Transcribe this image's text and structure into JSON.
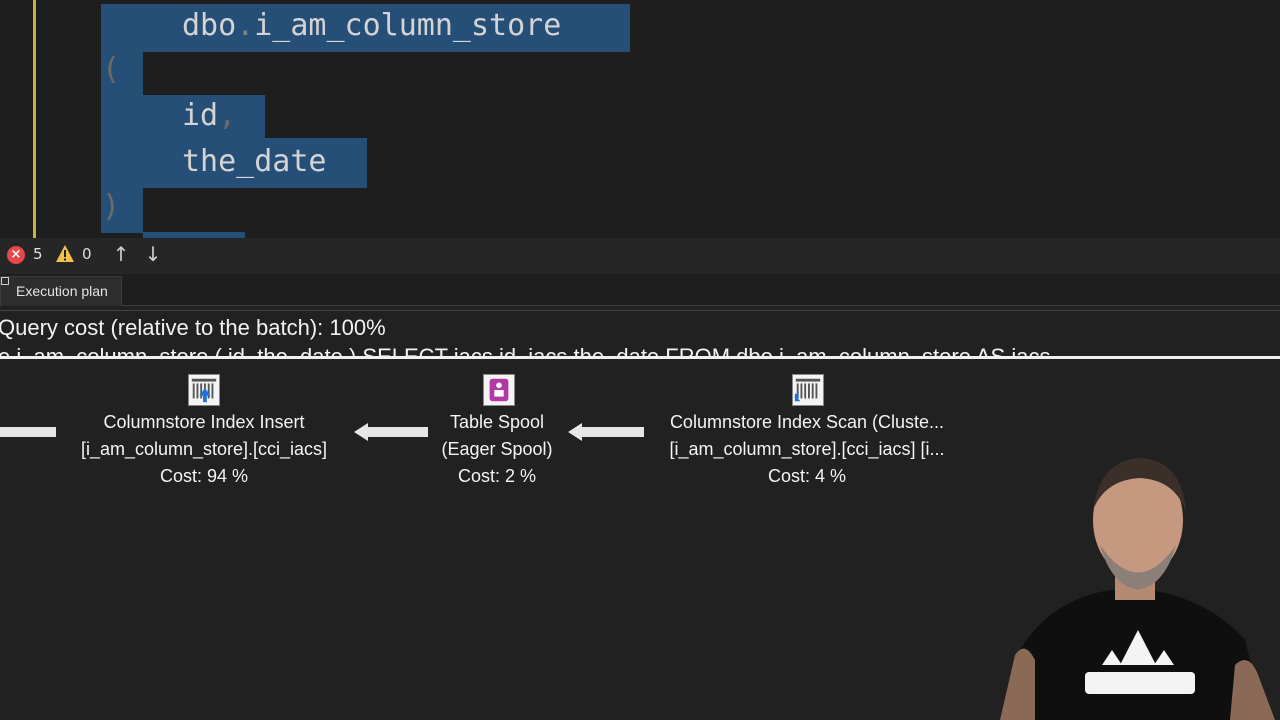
{
  "editor": {
    "line1_schema": "dbo",
    "line1_dot": ".",
    "line1_table": "i_am_column_store",
    "open_paren": "(",
    "col1": "id",
    "col1_comma": ",",
    "col2": "the_date",
    "close_paren": ")"
  },
  "status": {
    "errors": "5",
    "warnings": "0",
    "up_arrow": "↑",
    "down_arrow": "↓"
  },
  "tabs": [
    {
      "label": "Execution plan"
    }
  ],
  "plan": {
    "query_cost": "Query cost (relative to the batch): 100%",
    "query_text": "e i_am_column_store ( id, the_date ) SELECT iacs.id, iacs.the_date FROM dbo.i_am_column_store AS iacs",
    "operators": [
      {
        "name": "Columnstore Index Insert",
        "object": "[i_am_column_store].[cci_iacs]",
        "cost": "Cost: 94 %"
      },
      {
        "name": "Table Spool",
        "object": "(Eager Spool)",
        "cost": "Cost: 2 %"
      },
      {
        "name": "Columnstore Index Scan (Cluste...",
        "object": "[i_am_column_store].[cci_iacs]  [i...",
        "cost": "Cost: 4 %"
      }
    ]
  },
  "colors": {
    "selection": "#264f78",
    "error": "#e5484d",
    "warning": "#f2c14e",
    "spool_icon": "#b23aa6",
    "index_icon_arrow": "#1e73d8"
  },
  "icons": [
    "error-icon",
    "warning-icon",
    "arrow-up-icon",
    "arrow-down-icon",
    "columnstore-insert-icon",
    "table-spool-icon",
    "columnstore-scan-icon"
  ]
}
